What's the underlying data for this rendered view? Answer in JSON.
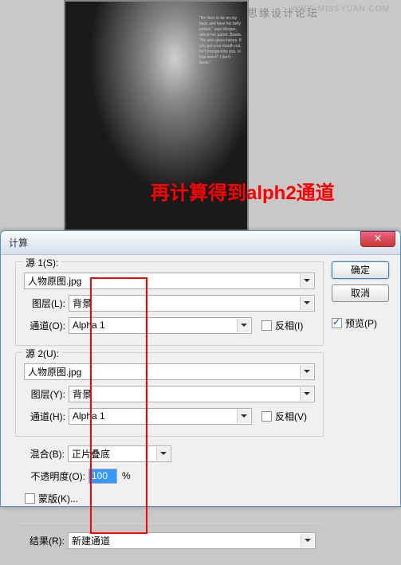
{
  "watermark": "思缘设计论坛",
  "watermark2": "WWW.MISSYUAN.COM",
  "annotation": "再计算得到alph2通道",
  "article": "\"He likes to be on my back and have his belly petted,\" says Megan, about her parrot, Bowie. \"He also gives kisses. If you put your mouth out, he'll tounge-kiss you. Is that weird? I don't know.\"",
  "dialog": {
    "title": "计算",
    "ok": "确定",
    "cancel": "取消",
    "preview": "预览(P)",
    "source1": {
      "legend": "源 1(S):",
      "file": "人物原图.jpg",
      "layer_label": "图层(L):",
      "layer": "背景",
      "channel_label": "通道(O):",
      "channel": "Alpha 1",
      "invert": "反相(I)"
    },
    "source2": {
      "legend": "源 2(U):",
      "file": "人物原图.jpg",
      "layer_label": "图层(Y):",
      "layer": "背景",
      "channel_label": "通道(H):",
      "channel": "Alpha 1",
      "invert": "反相(V)"
    },
    "blend": {
      "label": "混合(B):",
      "mode": "正片叠底",
      "opacity_label": "不透明度(O):",
      "opacity": "100",
      "pct": "%",
      "mask": "蒙版(K)..."
    },
    "result": {
      "label": "结果(R):",
      "value": "新建通道"
    }
  }
}
